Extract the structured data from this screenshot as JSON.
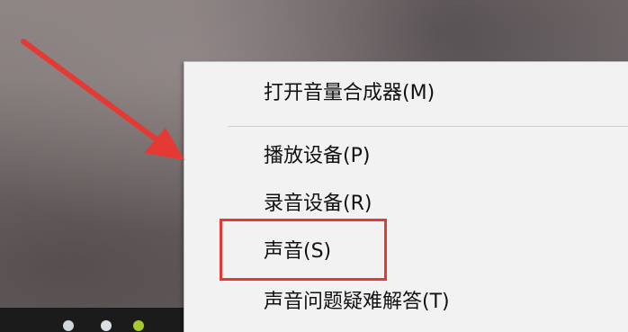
{
  "menu": {
    "items": [
      {
        "label": "打开音量合成器(M)"
      },
      {
        "label": "播放设备(P)"
      },
      {
        "label": "录音设备(R)"
      },
      {
        "label": "声音(S)"
      },
      {
        "label": "声音问题疑难解答(T)"
      }
    ]
  },
  "annotation": {
    "arrow_color": "#e53935",
    "box_color": "#e53935"
  }
}
